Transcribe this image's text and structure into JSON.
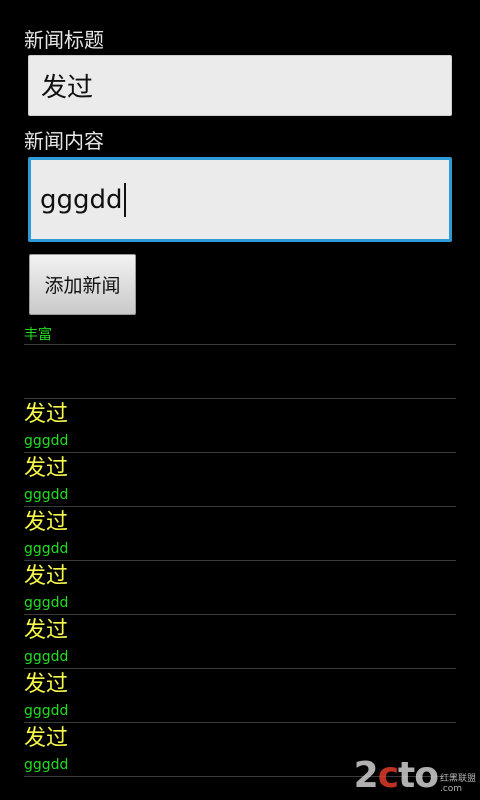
{
  "form": {
    "title_label": "新闻标题",
    "title_value": "发过",
    "content_label": "新闻内容",
    "content_value": "gggdd",
    "add_button_label": "添加新闻"
  },
  "previous_item": {
    "content": "丰富"
  },
  "news_list": [
    {
      "title": "发过",
      "content": "gggdd"
    },
    {
      "title": "发过",
      "content": "gggdd"
    },
    {
      "title": "发过",
      "content": "gggdd"
    },
    {
      "title": "发过",
      "content": "gggdd"
    },
    {
      "title": "发过",
      "content": "gggdd"
    },
    {
      "title": "发过",
      "content": "gggdd"
    },
    {
      "title": "发过",
      "content": "gggdd"
    }
  ],
  "watermark": {
    "main_prefix": "2",
    "main_dot": "c",
    "main_suffix": "to",
    "side_top": "红黑联盟",
    "side_bottom": ".com"
  },
  "colors": {
    "background": "#000000",
    "news_title": "#f7f74a",
    "news_content": "#22dd22",
    "focus_border": "#2e9bd6"
  }
}
